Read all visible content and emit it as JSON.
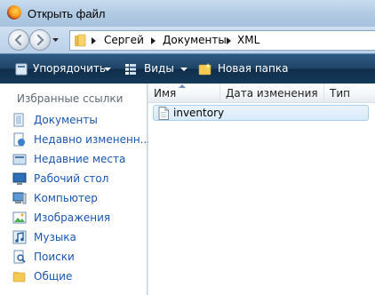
{
  "window": {
    "title": "Открыть файл"
  },
  "address": {
    "crumbs": [
      "Сергей",
      "Документы",
      "XML"
    ]
  },
  "toolbar": {
    "organize_label": "Упорядочить",
    "views_label": "Виды",
    "new_folder_label": "Новая папка"
  },
  "nav": {
    "title": "Избранные ссылки",
    "items": [
      {
        "label": "Документы",
        "icon": "documents-icon"
      },
      {
        "label": "Недавно измененн...",
        "icon": "recently-changed-icon"
      },
      {
        "label": "Недавние места",
        "icon": "recent-places-icon"
      },
      {
        "label": "Рабочий стол",
        "icon": "desktop-icon"
      },
      {
        "label": "Компьютер",
        "icon": "computer-icon"
      },
      {
        "label": "Изображения",
        "icon": "pictures-icon"
      },
      {
        "label": "Музыка",
        "icon": "music-icon"
      },
      {
        "label": "Поиски",
        "icon": "searches-icon"
      },
      {
        "label": "Общие",
        "icon": "public-icon"
      }
    ]
  },
  "columns": {
    "name": "Имя",
    "date": "Дата изменения",
    "type": "Тип"
  },
  "files": [
    {
      "name": "inventory"
    }
  ],
  "colors": {
    "toolbar": "#1f4466",
    "link": "#1a56b0",
    "selection": "#d8ebfa"
  }
}
